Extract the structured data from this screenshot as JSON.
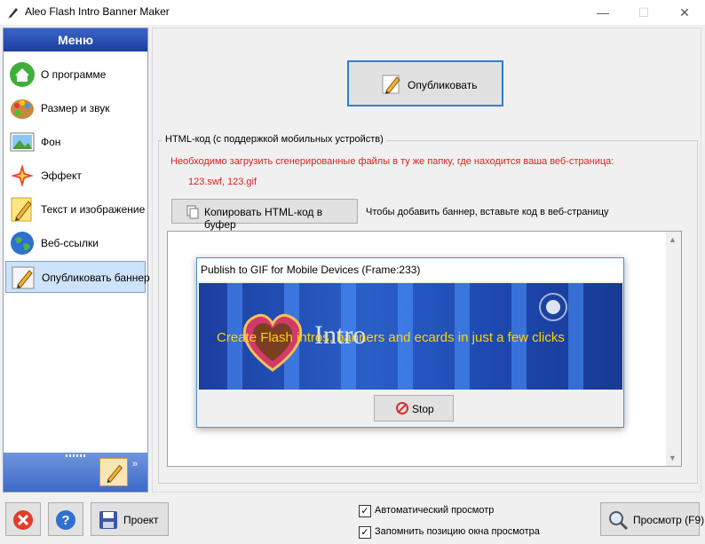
{
  "window": {
    "title": "Aleo Flash Intro Banner Maker",
    "minimize": "—",
    "maximize": "☐",
    "close": "✕"
  },
  "sidebar": {
    "header": "Меню",
    "items": [
      {
        "label": "О программе",
        "icon": "home-icon"
      },
      {
        "label": "Размер и звук",
        "icon": "palette-icon"
      },
      {
        "label": "Фон",
        "icon": "image-icon"
      },
      {
        "label": "Эффект",
        "icon": "sparkle-icon"
      },
      {
        "label": "Текст и изображение",
        "icon": "pencil-icon"
      },
      {
        "label": "Веб-ссылки",
        "icon": "globe-icon"
      },
      {
        "label": "Опубликовать баннер",
        "icon": "publish-icon",
        "active": true
      }
    ],
    "more": "»"
  },
  "main": {
    "publish_label": "Опубликовать",
    "group_legend": "HTML-код (с поддержкой мобильных устройств)",
    "warning": "Необходимо загрузить сгенерированные файлы в ту же папку, где находится ваша веб-страница:",
    "files": "123.swf, 123.gif",
    "copy_label": "Копировать HTML-код в буфер",
    "copy_hint": "Чтобы добавить баннер, вставьте код в веб-страницу"
  },
  "popup": {
    "title": "Publish to GIF for Mobile Devices (Frame:233)",
    "banner_text": "Create Flash intros, banners and ecards  in just a few clicks",
    "banner_intro": "Intro",
    "stop_label": "Stop"
  },
  "bottom": {
    "project_label": "Проект",
    "auto_preview_label": "Автоматический просмотр",
    "auto_preview_checked": true,
    "remember_pos_label": "Запомнить позицию окна просмотра",
    "remember_pos_checked": true,
    "preview_label": "Просмотр (F9)"
  },
  "colors": {
    "accent": "#2f7fd3",
    "warning": "#e02020",
    "menu_header": "#2a52b8"
  }
}
